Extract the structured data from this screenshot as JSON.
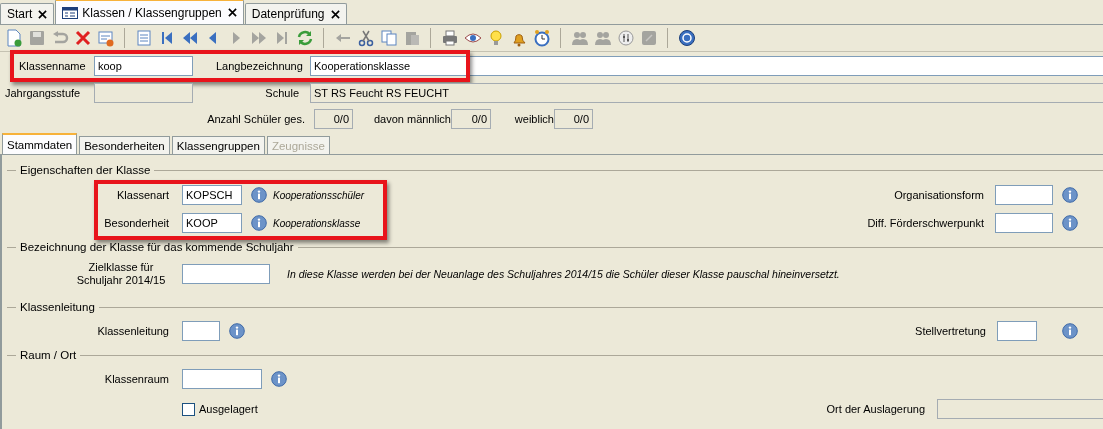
{
  "tabs": [
    {
      "label": "Start",
      "selected": false
    },
    {
      "label": "Klassen / Klassengruppen",
      "selected": true
    },
    {
      "label": "Datenprüfung",
      "selected": false
    }
  ],
  "toolbar": [
    [
      {
        "kind": "new",
        "disabled": false
      },
      {
        "kind": "save",
        "disabled": true
      },
      {
        "kind": "undo",
        "disabled": true
      },
      {
        "kind": "delete",
        "disabled": false
      },
      {
        "kind": "form",
        "disabled": false
      }
    ],
    [
      {
        "kind": "table",
        "disabled": false
      },
      {
        "kind": "first",
        "disabled": false
      },
      {
        "kind": "rewind",
        "disabled": false
      },
      {
        "kind": "prev",
        "disabled": false
      },
      {
        "kind": "next",
        "disabled": true
      },
      {
        "kind": "forward",
        "disabled": true
      },
      {
        "kind": "last",
        "disabled": true
      },
      {
        "kind": "refresh",
        "disabled": false
      }
    ],
    [
      {
        "kind": "back",
        "disabled": true
      },
      {
        "kind": "cut",
        "disabled": false
      },
      {
        "kind": "copy",
        "disabled": false
      },
      {
        "kind": "paste",
        "disabled": true
      }
    ],
    [
      {
        "kind": "print",
        "disabled": false
      },
      {
        "kind": "eye",
        "disabled": false
      },
      {
        "kind": "bulb",
        "disabled": false
      },
      {
        "kind": "bell",
        "disabled": false
      },
      {
        "kind": "clock",
        "disabled": false
      }
    ],
    [
      {
        "kind": "people",
        "disabled": true
      },
      {
        "kind": "people",
        "disabled": true
      },
      {
        "kind": "tune",
        "disabled": false
      },
      {
        "kind": "note",
        "disabled": true
      }
    ],
    [
      {
        "kind": "help",
        "disabled": false
      }
    ]
  ],
  "header": {
    "highlighted": true,
    "klassenname": {
      "label": "Klassenname",
      "value": "koop"
    },
    "langbezeichnung": {
      "label": "Langbezeichnung",
      "value": "Kooperationsklasse"
    },
    "jahrgangsstufe": {
      "label": "Jahrgangsstufe",
      "disabled": true
    },
    "schule": {
      "label": "Schule",
      "value": "ST RS Feucht RS FEUCHT"
    },
    "counts": [
      {
        "label": "Anzahl Schüler ges.",
        "value": "0/0"
      },
      {
        "label": "davon männlich",
        "value": "0/0"
      },
      {
        "label": "weiblich",
        "value": "0/0"
      }
    ]
  },
  "subtabs": [
    {
      "label": "Stammdaten",
      "selected": true,
      "disabled": false
    },
    {
      "label": "Besonderheiten",
      "selected": false,
      "disabled": false
    },
    {
      "label": "Klassengruppen",
      "selected": false,
      "disabled": false
    },
    {
      "label": "Zeugnisse",
      "selected": false,
      "disabled": true
    }
  ],
  "eigenschaften": {
    "title": "Eigenschaften der Klasse",
    "highlighted": true,
    "rows": [
      {
        "label": "Klassenart",
        "value": "KOPSCH",
        "description": "Kooperationsschüler",
        "right_label": "Organisationsform"
      },
      {
        "label": "Besonderheit",
        "value": "KOOP",
        "description": "Kooperationsklasse",
        "right_label": "Diff. Förderschwerpunkt"
      }
    ]
  },
  "kommendes_schuljahr": {
    "title": "Bezeichnung der Klasse für das kommende Schuljahr",
    "label": "Zielklasse für Schuljahr 2014/15",
    "note": "In diese Klasse werden bei der Neuanlage des Schuljahres 2014/15 die Schüler dieser Klasse pauschal hineinversetzt."
  },
  "klassenleitung": {
    "title": "Klassenleitung",
    "label": "Klassenleitung",
    "right_label": "Stellvertretung"
  },
  "raum": {
    "title": "Raum / Ort",
    "label": "Klassenraum",
    "checkbox": {
      "label": "Ausgelagert",
      "checked": false
    },
    "right_label": "Ort der Auslagerung"
  }
}
